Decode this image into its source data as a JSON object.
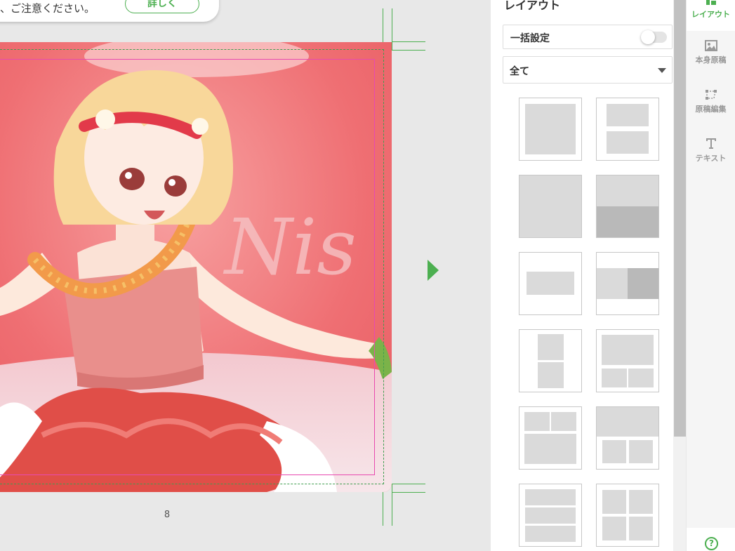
{
  "notice": {
    "text": "、ご注意ください。",
    "detail_button": "詳しく"
  },
  "canvas": {
    "page_number": "8",
    "photo_text": "Nis"
  },
  "panel": {
    "title": "レイアウト",
    "bulk_setting_label": "一括設定",
    "bulk_setting_on": false,
    "filter": {
      "value": "全て"
    },
    "layouts": [
      "full-single",
      "two-row-with-margin",
      "full-bleed",
      "top-light-bottom-dark",
      "center-wide",
      "left-light-right-dark",
      "two-vertical",
      "top-large-bottom-two",
      "top-two-bottom-large",
      "top-full-bottom-two",
      "three-rows",
      "two-by-two"
    ]
  },
  "sidebar": {
    "items": [
      {
        "label": "レイアウト",
        "icon": "layout-icon",
        "active": true
      },
      {
        "label": "本身原稿",
        "icon": "image-icon",
        "active": false
      },
      {
        "label": "原稿編集",
        "icon": "crop-edit-icon",
        "active": false
      },
      {
        "label": "テキスト",
        "icon": "text-icon",
        "active": false
      }
    ],
    "help": "?"
  },
  "colors": {
    "accent": "#4caf50",
    "guide_safe": "#e84ab0",
    "photo_bg": "#ef6f73"
  }
}
